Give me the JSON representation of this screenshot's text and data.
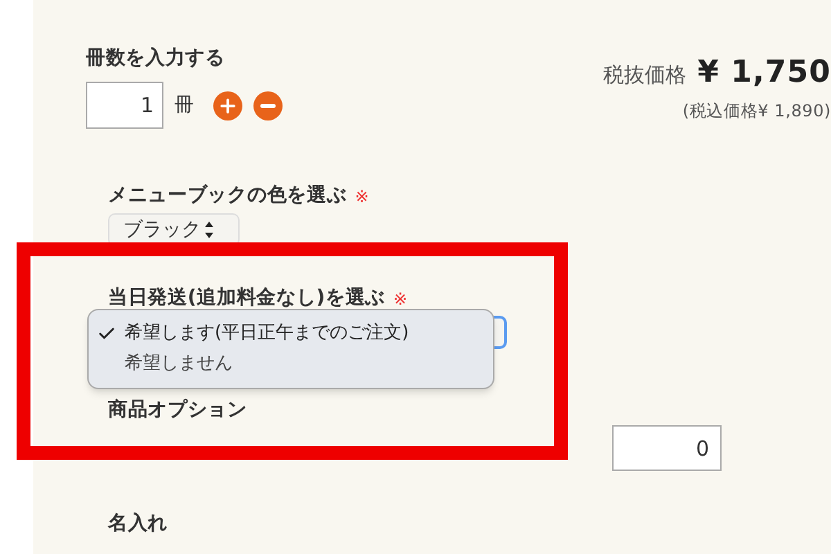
{
  "quantity": {
    "label": "冊数を入力する",
    "value": "1",
    "unit": "冊"
  },
  "price": {
    "label": "税抜価格",
    "value": "¥ 1,750",
    "tax_included": "(税込価格¥ 1,890)"
  },
  "color_select": {
    "label": "メニューブックの色を選ぶ",
    "required_mark": "※",
    "value": "ブラック"
  },
  "shipping_select": {
    "label": "当日発送(追加料金なし)を選ぶ",
    "required_mark": "※",
    "options": [
      {
        "label": "希望します(平日正午までのご注文)",
        "selected": true
      },
      {
        "label": "希望しません",
        "selected": false
      }
    ]
  },
  "product_options": {
    "title": "商品オプション",
    "rows": [
      {
        "value": "0"
      }
    ]
  },
  "name_engraving": {
    "title": "名入れ"
  }
}
